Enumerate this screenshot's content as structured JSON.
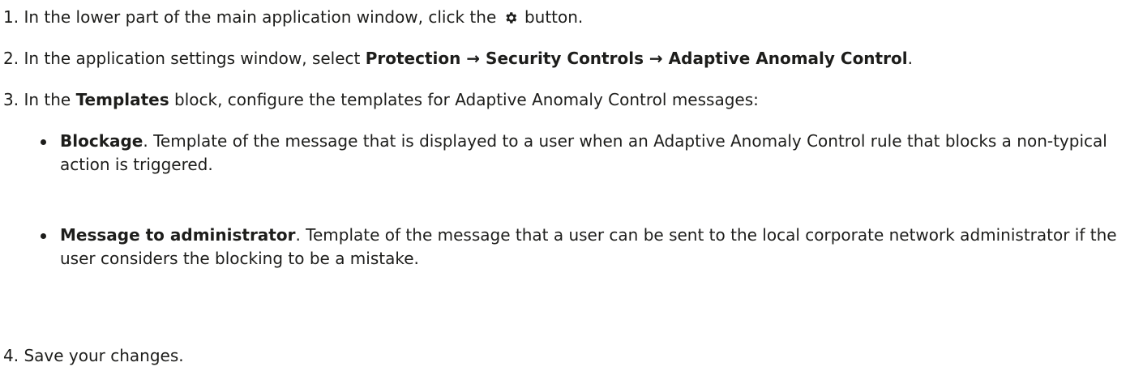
{
  "steps": {
    "s1": {
      "before": "1. In the lower part of the main application window, click the ",
      "icon": "gear-icon",
      "after": " button."
    },
    "s2": {
      "before": "2. In the application settings window, select ",
      "path": [
        "Protection",
        "Security Controls",
        "Adaptive Anomaly Control"
      ],
      "arrow": " → ",
      "after": "."
    },
    "s3": {
      "before": "3. In the ",
      "bold": "Templates",
      "after": " block, configure the templates for Adaptive Anomaly Control messages:"
    },
    "s4": {
      "text": "4. Save your changes."
    }
  },
  "bullets": [
    {
      "title": "Blockage",
      "text": ". Template of the message that is displayed to a user when an Adaptive Anomaly Control rule that blocks a non-typical action is triggered."
    },
    {
      "title": "Message to administrator",
      "text": ". Template of the message that a user can be sent to the local corporate network administrator if the user considers the blocking to be a mistake."
    }
  ]
}
